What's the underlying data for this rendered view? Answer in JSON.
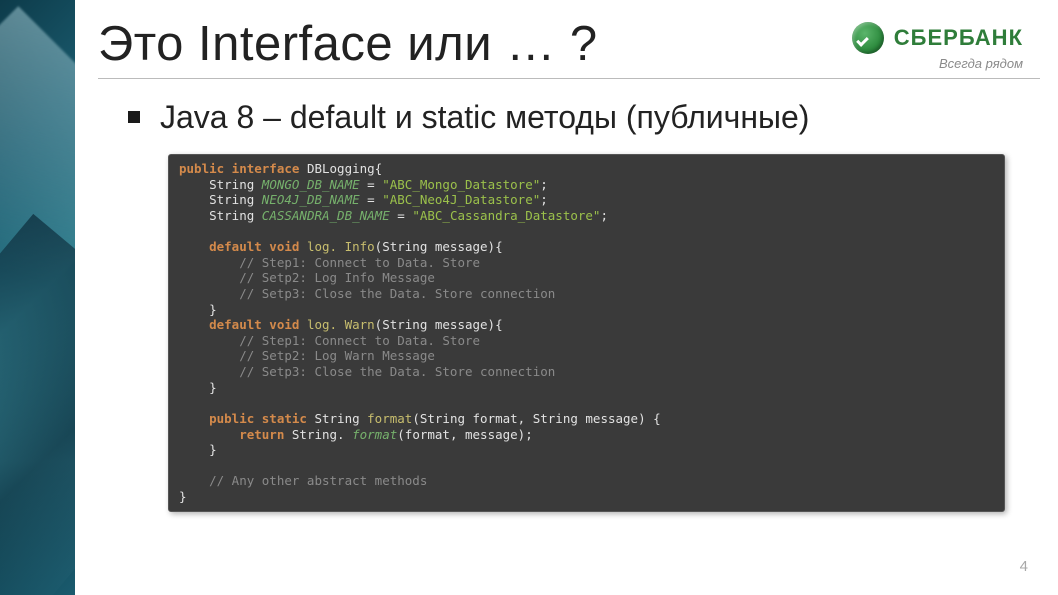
{
  "logo": {
    "brand": "СБЕРБАНК",
    "tagline": "Всегда рядом"
  },
  "title": "Это Interface или … ?",
  "bullet": "Java 8 – default и static методы (публичные)",
  "page_number": "4",
  "code": {
    "l01a": "public interface ",
    "l01b": "DBLogging{",
    "l02a": "    String ",
    "l02b": "MONGO_DB_NAME",
    "l02c": " = ",
    "l02d": "\"ABC_Mongo_Datastore\"",
    "l02e": ";",
    "l03a": "    String ",
    "l03b": "NEO4J_DB_NAME",
    "l03c": " = ",
    "l03d": "\"ABC_Neo4J_Datastore\"",
    "l03e": ";",
    "l04a": "    String ",
    "l04b": "CASSANDRA_DB_NAME",
    "l04c": " = ",
    "l04d": "\"ABC_Cassandra_Datastore\"",
    "l04e": ";",
    "l05": " ",
    "l06a": "    default void ",
    "l06b": "log. Info",
    "l06c": "(String message){",
    "l07": "        // Step1: Connect to Data. Store",
    "l08": "        // Setp2: Log Info Message",
    "l09": "        // Setp3: Close the Data. Store connection",
    "l10": "    }",
    "l11a": "    default void ",
    "l11b": "log. Warn",
    "l11c": "(String message){",
    "l12": "        // Step1: Connect to Data. Store",
    "l13": "        // Setp2: Log Warn Message",
    "l14": "        // Setp3: Close the Data. Store connection",
    "l15": "    }",
    "l16": " ",
    "l17a": "    public static ",
    "l17b": "String ",
    "l17c": "format",
    "l17d": "(String format, String message) {",
    "l18a": "        return ",
    "l18b": "String. ",
    "l18c": "format",
    "l18d": "(format, message);",
    "l19": "    }",
    "l20": " ",
    "l21": "    // Any other abstract methods",
    "l22": "}"
  }
}
